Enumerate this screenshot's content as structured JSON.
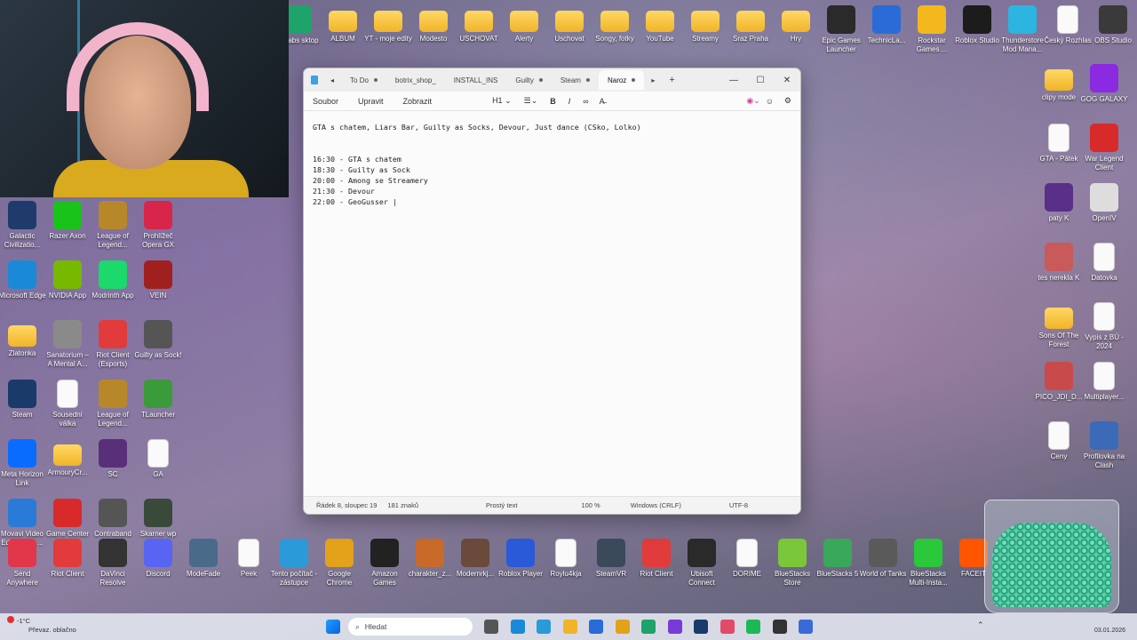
{
  "desktop_top_row": [
    {
      "label": "amlabs\nsktop",
      "icon": "app-icon",
      "color": "#1ea36b"
    },
    {
      "label": "ALBUM",
      "icon": "folder-icon"
    },
    {
      "label": "YT - moje edity",
      "icon": "folder-icon"
    },
    {
      "label": "Modesto",
      "icon": "folder-icon"
    },
    {
      "label": "USCHOVAT",
      "icon": "folder-icon"
    },
    {
      "label": "Alerty",
      "icon": "folder-icon"
    },
    {
      "label": "Uschovat",
      "icon": "folder-icon"
    },
    {
      "label": "Songy, fotky",
      "icon": "folder-icon"
    },
    {
      "label": "YouTube",
      "icon": "folder-icon"
    },
    {
      "label": "Streamy",
      "icon": "folder-icon"
    },
    {
      "label": "Sraz Praha",
      "icon": "folder-icon"
    },
    {
      "label": "Hry",
      "icon": "folder-icon"
    },
    {
      "label": "Epic Games Launcher",
      "icon": "epic-icon",
      "color": "#2a2a2a"
    },
    {
      "label": "TechnicLa...",
      "icon": "technic-icon",
      "color": "#2a6bd8"
    },
    {
      "label": "Rockstar Games ...",
      "icon": "rockstar-icon",
      "color": "#f2b81d"
    },
    {
      "label": "Roblox Studio",
      "icon": "roblox-icon",
      "color": "#1c1c1c"
    },
    {
      "label": "Thunderstore Mod Mana...",
      "icon": "thunderstore-icon",
      "color": "#2bb5e0"
    },
    {
      "label": "Český Rozhlas",
      "icon": "document-icon"
    },
    {
      "label": "OBS Studio",
      "icon": "obs-icon",
      "color": "#3a3a3a"
    }
  ],
  "desktop_left": [
    {
      "label": "Galactic Civilizatio...",
      "icon": "game-icon",
      "color": "#1f3b6b"
    },
    {
      "label": "Razer Axon",
      "icon": "razer-icon",
      "color": "#1ac31a"
    },
    {
      "label": "League of Legend...",
      "icon": "lol-icon",
      "color": "#b8872a"
    },
    {
      "label": "Prohlížeč Opera GX",
      "icon": "opera-icon",
      "color": "#d8254a"
    },
    {
      "label": "Microsoft Edge",
      "icon": "edge-icon",
      "color": "#1a8ad8"
    },
    {
      "label": "NVIDIA App",
      "icon": "nvidia-icon",
      "color": "#76b900"
    },
    {
      "label": "Modrinth App",
      "icon": "modrinth-icon",
      "color": "#1bd96a"
    },
    {
      "label": "VEIN",
      "icon": "vein-icon",
      "color": "#a02020"
    },
    {
      "label": "Zlatonka",
      "icon": "folder-icon"
    },
    {
      "label": "Sanatorium – A Mental A...",
      "icon": "game-icon",
      "color": "#8a8a8a"
    },
    {
      "label": "Riot Client (Esports)",
      "icon": "riot-icon",
      "color": "#e23b3b"
    },
    {
      "label": "Guilty as Sock!",
      "icon": "game-icon",
      "color": "#555555"
    },
    {
      "label": "Steam",
      "icon": "steam-icon",
      "color": "#1a3a6a"
    },
    {
      "label": "Sousední válka",
      "icon": "document-icon"
    },
    {
      "label": "League of Legend...",
      "icon": "lol-icon",
      "color": "#b8872a"
    },
    {
      "label": "TLauncher",
      "icon": "tlauncher-icon",
      "color": "#3a9b3a"
    },
    {
      "label": "Meta Horizon Link",
      "icon": "meta-icon",
      "color": "#0a6cff"
    },
    {
      "label": "ArmouryCr...",
      "icon": "folder-icon"
    },
    {
      "label": "SC",
      "icon": "game-icon",
      "color": "#5a2f7a"
    },
    {
      "label": "GA",
      "icon": "document-icon"
    },
    {
      "label": "Movavi Video Editor Plus ...",
      "icon": "movavi-icon",
      "color": "#2a7ad8"
    },
    {
      "label": "Game Center",
      "icon": "gamecenter-icon",
      "color": "#d82a2a"
    },
    {
      "label": "Contraband Police",
      "icon": "game-icon",
      "color": "#555555"
    },
    {
      "label": "Skarner wp",
      "icon": "game-icon",
      "color": "#3a4a3a"
    }
  ],
  "desktop_right": [
    {
      "label": "clipy mode",
      "icon": "folder-icon"
    },
    {
      "label": "GOG GALAXY",
      "icon": "gog-icon",
      "color": "#8a2be2"
    },
    {
      "label": "GTA - Pátek",
      "icon": "document-icon"
    },
    {
      "label": "War Legend Client",
      "icon": "game-icon",
      "color": "#d82a2a"
    },
    {
      "label": "paty K",
      "icon": "game-icon",
      "color": "#5a2f8a"
    },
    {
      "label": "OpenIV",
      "icon": "openiv-icon",
      "color": "#dddddd"
    },
    {
      "label": "tes nerekla K",
      "icon": "game-icon",
      "color": "#c85a5a"
    },
    {
      "label": "Datovka",
      "icon": "document-icon"
    },
    {
      "label": "Sons Of The Forest",
      "icon": "folder-icon"
    },
    {
      "label": "Vypis z BÚ - 2024",
      "icon": "document-icon"
    },
    {
      "label": "PICO_JDI_D...",
      "icon": "game-icon",
      "color": "#c84a4a"
    },
    {
      "label": "Multiplayer...",
      "icon": "document-icon"
    },
    {
      "label": "Ceny",
      "icon": "document-icon"
    },
    {
      "label": "Profilovka na Clash",
      "icon": "game-icon",
      "color": "#3a6ab8"
    }
  ],
  "desktop_bottom_row": [
    {
      "label": "Send Anywhere",
      "icon": "sendanywhere-icon",
      "color": "#e2364a"
    },
    {
      "label": "Riot Client",
      "icon": "riot-icon",
      "color": "#e23b3b"
    },
    {
      "label": "DaVinci Resolve",
      "icon": "davinci-icon",
      "color": "#333333"
    },
    {
      "label": "Discord",
      "icon": "discord-icon",
      "color": "#5865f2"
    },
    {
      "label": "ModeFade",
      "icon": "game-icon",
      "color": "#4a6a8a"
    },
    {
      "label": "Peek",
      "icon": "document-icon"
    },
    {
      "label": "Tento počítač - zástupce",
      "icon": "computer-icon",
      "color": "#2a9ad8"
    },
    {
      "label": "Google Chrome",
      "icon": "chrome-icon",
      "color": "#e2a21a"
    },
    {
      "label": "Amazon Games",
      "icon": "amazon-icon",
      "color": "#222222"
    },
    {
      "label": "charakter_z...",
      "icon": "game-icon",
      "color": "#c86a2a"
    },
    {
      "label": "Modernrkj...",
      "icon": "game-icon",
      "color": "#6a4a3a"
    },
    {
      "label": "Roblox Player",
      "icon": "roblox-icon",
      "color": "#2a5ad8"
    },
    {
      "label": "Roylu4kja",
      "icon": "document-icon"
    },
    {
      "label": "SteamVR",
      "icon": "steamvr-icon",
      "color": "#3a4a5a"
    },
    {
      "label": "Riot Client",
      "icon": "riot-icon",
      "color": "#e23b3b"
    },
    {
      "label": "Ubisoft Connect",
      "icon": "ubisoft-icon",
      "color": "#2a2a2a"
    },
    {
      "label": "DORIME",
      "icon": "document-icon"
    },
    {
      "label": "BlueStacks Store",
      "icon": "bluestacks-icon",
      "color": "#7ac83a"
    },
    {
      "label": "BlueStacks 5",
      "icon": "bluestacks-icon",
      "color": "#3aa85a"
    },
    {
      "label": "World of Tanks",
      "icon": "wot-icon",
      "color": "#5a5a5a"
    },
    {
      "label": "BlueStacks Multi-Insta...",
      "icon": "bluestacks-icon",
      "color": "#2ac83a"
    },
    {
      "label": "FACEIT",
      "icon": "faceit-icon",
      "color": "#ff5500"
    }
  ],
  "notepad": {
    "tabs": [
      "To Do",
      "botrix_shop_",
      "INSTALL_INS",
      "Guilty",
      "Steam",
      "Naroz"
    ],
    "active_tab_index": 5,
    "new_tab": "+",
    "menu": [
      "Soubor",
      "Upravit",
      "Zobrazit"
    ],
    "heading_select": "H1",
    "lines": [
      "GTA s chatem, Liars Bar, Guilty as Socks, Devour, Just dance (CSko, Lolko)",
      "",
      "",
      "16:30 - GTA s chatem",
      "18:30 - Guilty as Sock",
      "20:00 - Among se Streamery",
      "21:30 - Devour",
      "22:00 - GeoGusser |"
    ],
    "status": {
      "position": "Řádek 8, sloupec 19",
      "chars": "181 znaků",
      "format": "Prostý text",
      "zoom": "100 %",
      "line_ending": "Windows (CRLF)",
      "encoding": "UTF-8"
    }
  },
  "taskbar": {
    "weather_temp": "-1°C",
    "weather_desc": "Převaz. oblačno",
    "search_placeholder": "Hledat",
    "date": "03.01.2026"
  }
}
